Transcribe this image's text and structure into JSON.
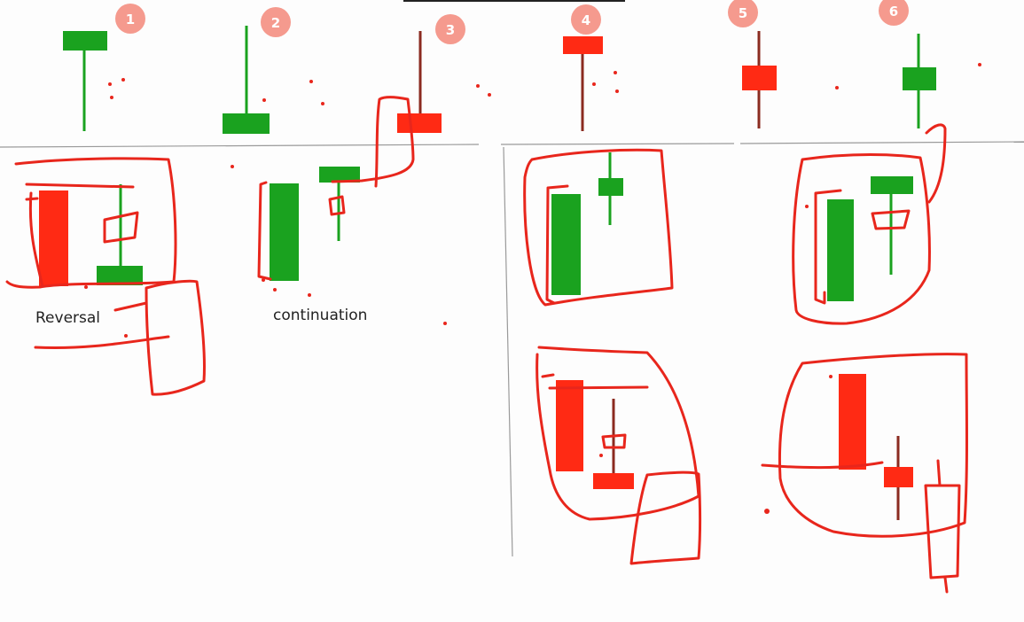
{
  "colors": {
    "bull": "#1aa21f",
    "bear": "#ff2a14",
    "bear_dark": "#8b2b20",
    "badge_fill": "#f59a8e",
    "badge_text": "#ffffff",
    "ink": "#e8261c",
    "divider": "#9a9a9a",
    "background": "#fdfdfd"
  },
  "top_patterns": [
    {
      "badge": "1",
      "color": "bull",
      "name": "inverted-hammer-green"
    },
    {
      "badge": "2",
      "color": "bull",
      "name": "hammer-green"
    },
    {
      "badge": "3",
      "color": "bear",
      "name": "hammer-red"
    },
    {
      "badge": "4",
      "color": "bear",
      "name": "inverted-hammer-red"
    },
    {
      "badge": "5",
      "color": "bear",
      "name": "spinning-top-red"
    },
    {
      "badge": "6",
      "color": "bull",
      "name": "spinning-top-green"
    }
  ],
  "examples": {
    "reversal_label": "Reversal",
    "continuation_label": "continuation"
  }
}
